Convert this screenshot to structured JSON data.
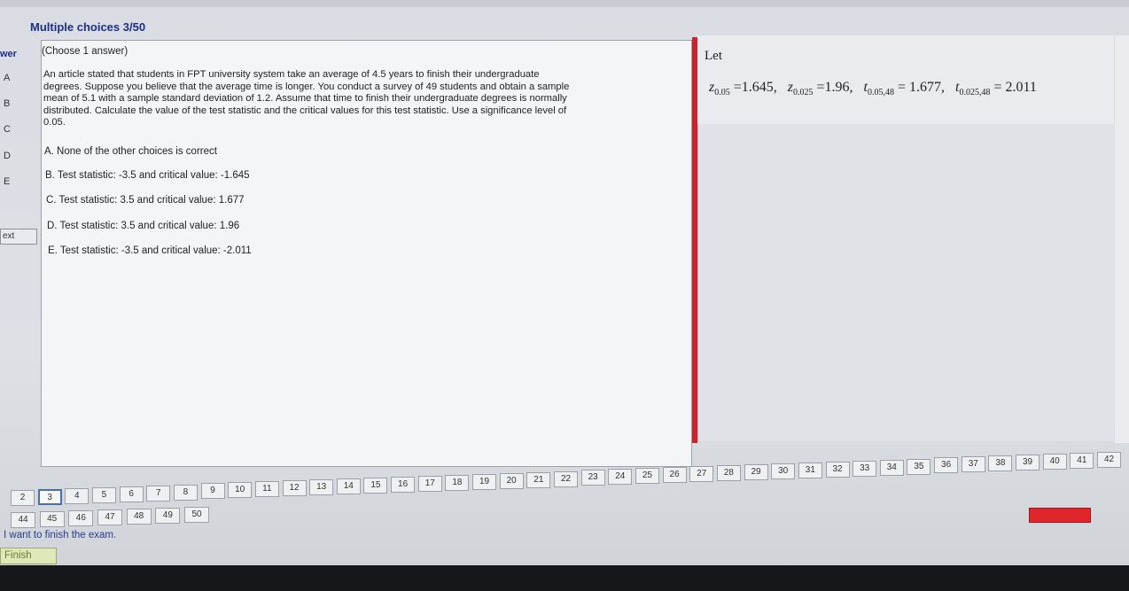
{
  "header": {
    "title": "Multiple choices 3/50"
  },
  "sidebar": {
    "answer_label": "wer",
    "letters": [
      "A",
      "B",
      "C",
      "D",
      "E"
    ],
    "next_label": "ext"
  },
  "question": {
    "choose_label": "(Choose 1 answer)",
    "text": "An article stated that students in FPT university system take an average of 4.5 years to finish their undergraduate degrees.  Suppose you believe that the average time is longer.  You conduct a survey of 49 students and obtain a sample mean of 5.1 with a sample standard deviation of 1.2. Assume that time to finish their undergraduate degrees is normally distributed. Calculate the value of the test statistic and the critical values for this test statistic. Use a significance level of 0.05.",
    "options": [
      "A. None of the other choices is correct",
      "B. Test statistic: -3.5 and critical value: -1.645",
      "C. Test statistic: 3.5 and critical value: 1.677",
      "D. Test statistic: 3.5 and critical value: 1.96",
      "E. Test statistic: -3.5 and critical value: -2.011"
    ]
  },
  "hint": {
    "let": "Let",
    "z1_sub": "0.05",
    "z1_val": "=1.645,",
    "z2_sub": "0.025",
    "z2_val": "=1.96,",
    "t1_sub": "0.05,48",
    "t1_val": "= 1.677,",
    "t2_sub": "0.025,48",
    "t2_val": "= 2.011",
    "z": "z",
    "t": "t"
  },
  "nav": {
    "row1": [
      "2",
      "3",
      "4",
      "5",
      "6",
      "7",
      "8",
      "9",
      "10",
      "11",
      "12",
      "13",
      "14",
      "15",
      "16",
      "17",
      "18",
      "19",
      "20",
      "21",
      "22",
      "23",
      "24",
      "25",
      "26",
      "27",
      "28",
      "29",
      "30",
      "31",
      "32",
      "33",
      "34",
      "35",
      "36",
      "37",
      "38",
      "39",
      "40",
      "41",
      "42"
    ],
    "row2": [
      "44",
      "45",
      "46",
      "47",
      "48",
      "49",
      "50"
    ],
    "current": "3"
  },
  "footer": {
    "finish_text": "I want to finish the exam.",
    "finish_button": "Finish"
  },
  "colors": {
    "title": "#1d2f86",
    "divider": "#d0202a",
    "finish_bg": "#dfe8b8"
  }
}
